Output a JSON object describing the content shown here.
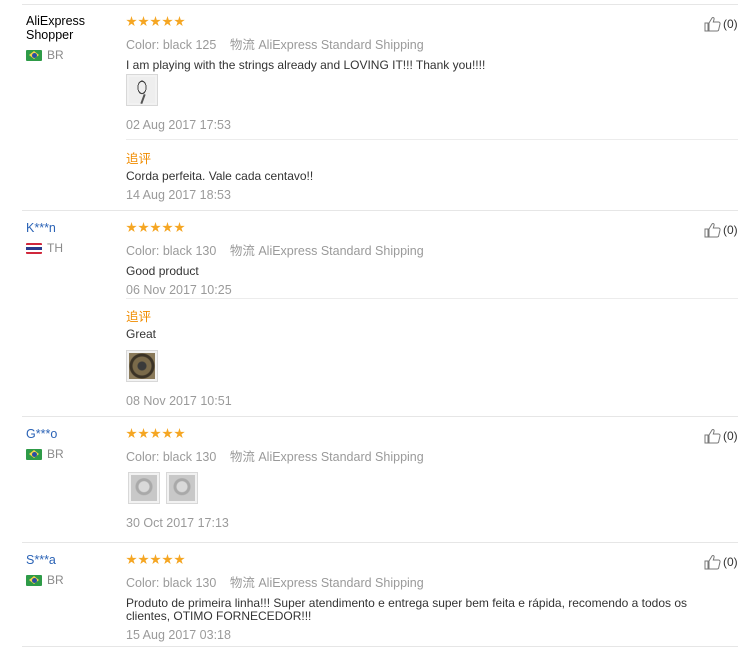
{
  "reviews": [
    {
      "user": "AliExpress Shopper",
      "user_lines": [
        "AliExpress",
        "Shopper"
      ],
      "user_is_link": false,
      "country": "BR",
      "flag": "flag-brazil",
      "stars": 5,
      "color_label": "Color:",
      "color_value": "black 125",
      "shipping_label": "物流",
      "shipping_value": "AliExpress Standard Shipping",
      "text": "I am playing with the strings already and LOVING IT!!! Thank you!!!!",
      "images": [
        "racket"
      ],
      "date": "02 Aug 2017 17:53",
      "followup": {
        "label": "追评",
        "text": "Corda perfeita. Vale cada centavo!!",
        "images": [],
        "date": "14 Aug 2017 18:53"
      },
      "likes": "(0)"
    },
    {
      "user": "K***n",
      "user_is_link": true,
      "country": "TH",
      "flag": "flag-thailand",
      "stars": 5,
      "color_label": "Color:",
      "color_value": "black 130",
      "shipping_label": "物流",
      "shipping_value": "AliExpress Standard Shipping",
      "text": "Good product",
      "images": [],
      "date": "06 Nov 2017 10:25",
      "followup": {
        "label": "追评",
        "text": "Great",
        "images": [
          "coil"
        ],
        "date": "08 Nov 2017 10:51"
      },
      "likes": "(0)"
    },
    {
      "user": "G***o",
      "user_is_link": true,
      "country": "BR",
      "flag": "flag-brazil",
      "stars": 5,
      "color_label": "Color:",
      "color_value": "black 130",
      "shipping_label": "物流",
      "shipping_value": "AliExpress Standard Shipping",
      "text": "",
      "images": [
        "pack",
        "pack"
      ],
      "date": "30 Oct 2017 17:13",
      "followup": null,
      "likes": "(0)"
    },
    {
      "user": "S***a",
      "user_is_link": true,
      "country": "BR",
      "flag": "flag-brazil",
      "stars": 5,
      "color_label": "Color:",
      "color_value": "black 130",
      "shipping_label": "物流",
      "shipping_value": "AliExpress Standard Shipping",
      "text_lines": [
        "Produto de primeira linha!!! Super atendimento e entrega super bem feita e rápida, recomendo a todos os",
        "clientes, OTIMO FORNECEDOR!!!"
      ],
      "images": [],
      "date": "15 Aug 2017 03:18",
      "followup": null,
      "likes": "(0)"
    }
  ]
}
